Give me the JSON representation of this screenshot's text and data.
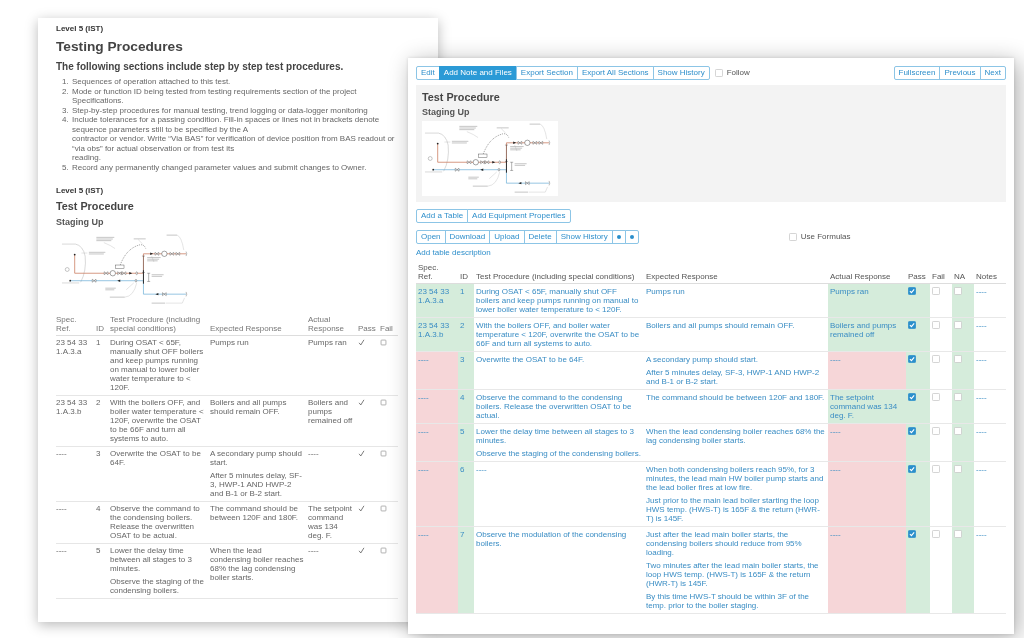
{
  "back_page": {
    "level_label": "Level 5 (IST)",
    "title": "Testing Procedures",
    "subtitle": "The following sections include step by step test procedures.",
    "notes": [
      {
        "number": "1.",
        "lines": [
          "Sequences of operation attached to this test."
        ]
      },
      {
        "number": "2.",
        "lines": [
          "Mode or function ID being tested from testing requirements section of the project Specifications."
        ]
      },
      {
        "number": "3.",
        "lines": [
          "Step-by-step procedures for manual testing, trend logging or data-logger monitoring"
        ]
      },
      {
        "number": "4.",
        "lines": [
          "Include tolerances for a passing condition. Fill-in spaces or lines not in brackets denote sequence parameters still to be specified by the A",
          "contractor or vendor. Write “Via BAS” for verification of device position from BAS readout or “via obs” for actual observation or from test its",
          "reading."
        ]
      },
      {
        "number": "5.",
        "lines": [
          "Record any permanently changed parameter values and submit changes to Owner."
        ]
      }
    ],
    "section": {
      "level_label": "Level 5 (IST)",
      "title": "Test Procedure",
      "subtitle": "Staging Up"
    },
    "table": {
      "columns": [
        "Spec. Ref.",
        "ID",
        "Test Procedure (including special conditions)",
        "Expected Response",
        "Actual Response",
        "Pass",
        "Fail"
      ],
      "rows": [
        {
          "spec_ref": "23 54 33 1.A.3.a",
          "id": "1",
          "procedure": [
            "During OSAT < 65F, manually shut OFF boilers and keep pumps running on manual to lower boiler water temperature to < 120F."
          ],
          "expected": [
            "Pumps run"
          ],
          "actual": "Pumps ran",
          "pass": true,
          "fail": false
        },
        {
          "spec_ref": "23 54 33 1.A.3.b",
          "id": "2",
          "procedure": [
            "With the boilers OFF, and boiler water temperature < 120F, overwrite the OSAT to be 66F and turn all systems to auto."
          ],
          "expected": [
            "Boilers and all pumps should remain OFF."
          ],
          "actual": "Boilers and pumps remained off",
          "pass": true,
          "fail": false
        },
        {
          "spec_ref": "----",
          "id": "3",
          "procedure": [
            "Overwrite the OSAT to be 64F."
          ],
          "expected": [
            "A secondary pump should start.",
            "After 5 minutes delay, SF-3, HWP-1 AND HWP-2 and B-1 or B-2 start."
          ],
          "actual": "----",
          "pass": true,
          "fail": false
        },
        {
          "spec_ref": "----",
          "id": "4",
          "procedure": [
            "Observe the command to the condensing boilers. Release the overwritten OSAT to be actual."
          ],
          "expected": [
            "The command should be between 120F and 180F."
          ],
          "actual": "The setpoint command was 134 deg. F.",
          "pass": true,
          "fail": false
        },
        {
          "spec_ref": "----",
          "id": "5",
          "procedure": [
            "Lower the delay time between all stages to 3 minutes.",
            "Observe the staging of the condensing boilers."
          ],
          "expected": [
            "When the lead condensing boiler reaches 68% the lag condensing boiler starts."
          ],
          "actual": "----",
          "pass": true,
          "fail": false
        }
      ]
    }
  },
  "front_window": {
    "toolbar": {
      "buttons": [
        {
          "label": "Edit",
          "selected": false
        },
        {
          "label": "Add Note and Files",
          "selected": true
        },
        {
          "label": "Export Section",
          "selected": false
        },
        {
          "label": "Export All Sections",
          "selected": false
        },
        {
          "label": "Show History",
          "selected": false
        }
      ],
      "follow": {
        "label": "Follow",
        "checked": false
      },
      "nav_buttons": [
        "Fullscreen",
        "Previous",
        "Next"
      ]
    },
    "title": "Test Procedure",
    "subtitle": "Staging Up",
    "section_buttons": [
      "Add a Table",
      "Add Equipment Properties"
    ],
    "table_buttons": [
      "Open",
      "Download",
      "Upload",
      "Delete",
      "Show History"
    ],
    "use_formulas": {
      "label": "Use Formulas",
      "checked": false
    },
    "description_link": "Add table description",
    "table": {
      "columns": [
        {
          "label": "Spec. Ref."
        },
        {
          "label": "ID",
          "color": "#d5ecdb"
        },
        {
          "label": "Test Procedure (including special conditions)"
        },
        {
          "label": "Expected Response"
        },
        {
          "label": "Actual Response"
        },
        {
          "label": "Pass",
          "color": "#d5ecdb"
        },
        {
          "label": "Fail"
        },
        {
          "label": "NA",
          "color": "#d5ecdb"
        },
        {
          "label": "Notes"
        }
      ],
      "rows": [
        {
          "spec_ref": {
            "text": "23 54 33 1.A.3.a",
            "color": "#d5ecdb"
          },
          "id": "1",
          "procedure": [
            "During OSAT < 65F, manually shut OFF boilers and keep pumps running on manual to lower boiler water temperature to < 120F."
          ],
          "expected": [
            "Pumps run"
          ],
          "actual": {
            "text": "Pumps ran",
            "color": "#d5ecdb"
          },
          "pass": true,
          "fail": false,
          "na": false,
          "notes": "----"
        },
        {
          "spec_ref": {
            "text": "23 54 33 1.A.3.b",
            "color": "#d5ecdb"
          },
          "id": "2",
          "procedure": [
            "With the boilers OFF, and boiler water temperature < 120F, overwrite the OSAT to be 66F and turn all systems to auto."
          ],
          "expected": [
            "Boilers and all pumps should remain OFF."
          ],
          "actual": {
            "text": "Boilers and pumps remained off",
            "color": "#d5ecdb"
          },
          "pass": true,
          "fail": false,
          "na": false,
          "notes": "----"
        },
        {
          "spec_ref": {
            "text": "----",
            "color": "#f6d6d8"
          },
          "id": "3",
          "procedure": [
            "Overwrite the OSAT to be 64F."
          ],
          "expected": [
            "A secondary pump should start.",
            "After 5 minutes delay, SF-3, HWP-1 AND HWP-2 and B-1 or B-2 start."
          ],
          "actual": {
            "text": "----",
            "color": "#f6d6d8"
          },
          "pass": true,
          "fail": false,
          "na": false,
          "notes": "----"
        },
        {
          "spec_ref": {
            "text": "----",
            "color": "#f6d6d8"
          },
          "id": "4",
          "procedure": [
            "Observe the command to the condensing boilers. Release the overwritten OSAT to be actual."
          ],
          "expected": [
            "The command should be between 120F and 180F."
          ],
          "actual": {
            "text": "The setpoint command was 134 deg. F.",
            "color": "#d5ecdb"
          },
          "pass": true,
          "fail": false,
          "na": false,
          "notes": "----"
        },
        {
          "spec_ref": {
            "text": "----",
            "color": "#f6d6d8"
          },
          "id": "5",
          "procedure": [
            "Lower the delay time between all stages to 3 minutes.",
            "Observe the staging of the condensing boilers."
          ],
          "expected": [
            "When the lead condensing boiler reaches 68% the lag condensing boiler starts."
          ],
          "actual": {
            "text": "----",
            "color": "#f6d6d8"
          },
          "pass": true,
          "fail": false,
          "na": false,
          "notes": "----"
        },
        {
          "spec_ref": {
            "text": "----",
            "color": "#f6d6d8"
          },
          "id": "6",
          "procedure": [
            "----"
          ],
          "expected": [
            "When both condensing boilers reach 95%, for 3 minutes, the lead main HW boiler pump starts and the lead boiler fires at low fire.",
            "Just prior to the main lead boiler starting the loop HWS temp. (HWS-T) is 165F & the return (HWR-T) is 145F."
          ],
          "actual": {
            "text": "----",
            "color": "#f6d6d8"
          },
          "pass": true,
          "fail": false,
          "na": false,
          "notes": "----"
        },
        {
          "spec_ref": {
            "text": "----",
            "color": "#f6d6d8"
          },
          "id": "7",
          "procedure": [
            "Observe the modulation of the condensing boilers."
          ],
          "expected": [
            "Just after the lead main boiler starts, the condensing boilers should reduce from 95% loading.",
            "Two minutes after the lead main boiler starts, the loop HWS temp. (HWS-T) is 165F & the return (HWR-T) is 145F.",
            "By this time HWS-T should be within 3F of the temp. prior to the boiler staging."
          ],
          "actual": {
            "text": "----",
            "color": "#f6d6d8"
          },
          "pass": true,
          "fail": false,
          "na": false,
          "notes": "----"
        }
      ]
    }
  }
}
